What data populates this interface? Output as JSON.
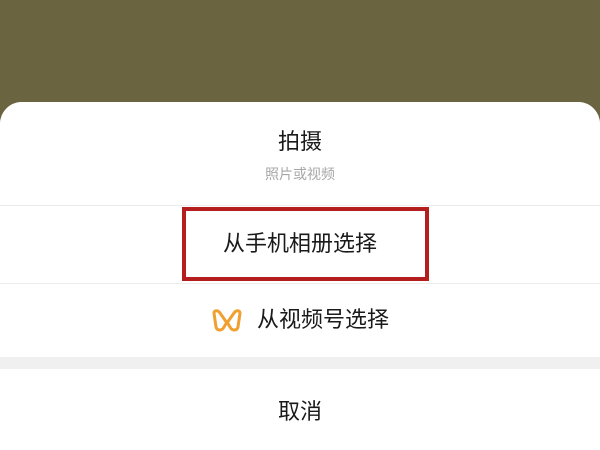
{
  "action_sheet": {
    "take_photo": {
      "title": "拍摄",
      "subtitle": "照片或视频"
    },
    "choose_from_album": "从手机相册选择",
    "choose_from_channels": "从视频号选择",
    "cancel": "取消"
  },
  "colors": {
    "backdrop": "#6b6440",
    "highlight_box": "#b41e1e",
    "channels_icon": "#f0a030"
  },
  "icons": {
    "channels": "wechat-channels-icon"
  }
}
